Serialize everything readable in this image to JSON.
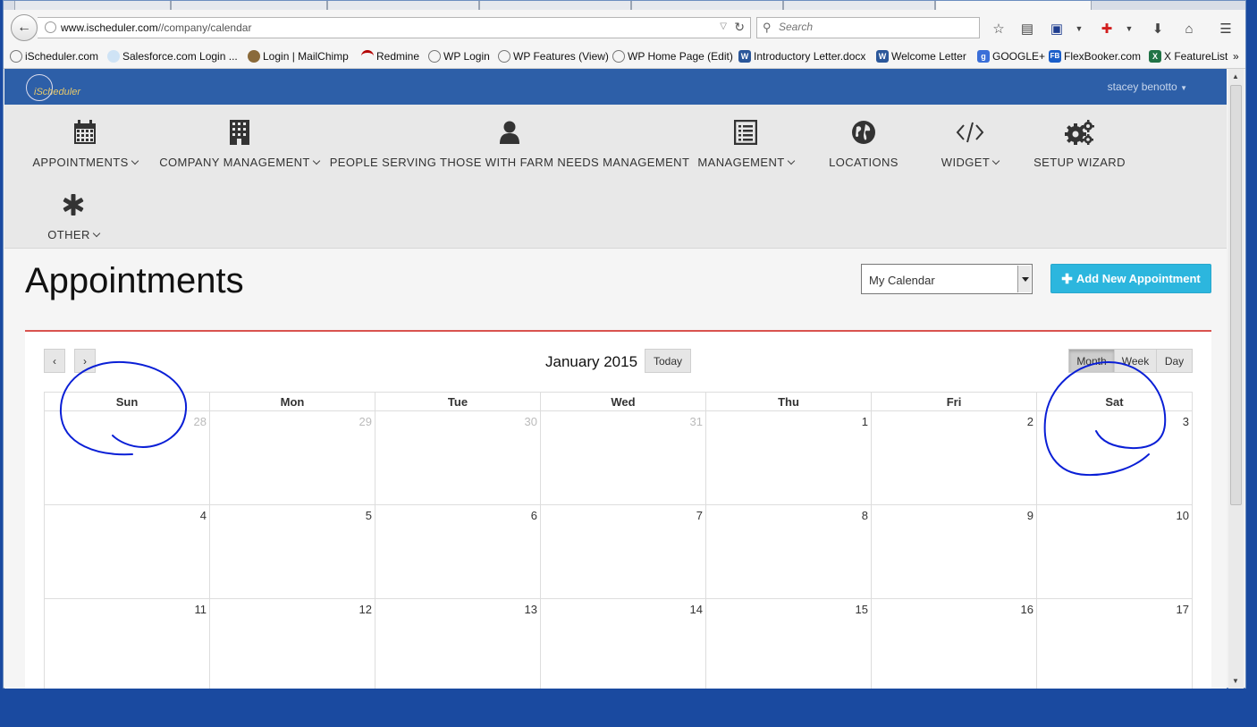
{
  "browser": {
    "url_domain": "www.ischeduler.com",
    "url_path": "//company/calendar",
    "search_placeholder": "Search"
  },
  "bookmarks": [
    {
      "label": "iScheduler.com",
      "icon": "check-circle-icon"
    },
    {
      "label": "Salesforce.com Login ...",
      "icon": "cloud-icon"
    },
    {
      "label": "Login | MailChimp",
      "icon": "chimp-icon"
    },
    {
      "label": "Redmine",
      "icon": "redmine-icon"
    },
    {
      "label": "WP Login",
      "icon": "check-circle-icon"
    },
    {
      "label": "WP Features (View)",
      "icon": "check-circle-icon"
    },
    {
      "label": "WP Home Page (Edit)",
      "icon": "check-circle-icon"
    },
    {
      "label": "Introductory Letter.docx",
      "icon": "word-icon"
    },
    {
      "label": "Welcome Letter",
      "icon": "word-icon"
    },
    {
      "label": "GOOGLE+",
      "icon": "google-icon"
    },
    {
      "label": "FlexBooker.com",
      "icon": "fb-icon"
    },
    {
      "label": "X FeatureList",
      "icon": "excel-icon"
    }
  ],
  "bookmarks_overflow": "»",
  "app": {
    "logo_text": "iScheduler",
    "user_name": "stacey benotto",
    "nav": [
      {
        "label": "APPOINTMENTS",
        "icon": "calendar-icon",
        "dropdown": true
      },
      {
        "label": "COMPANY MANAGEMENT",
        "icon": "building-icon",
        "dropdown": true
      },
      {
        "label": "PEOPLE SERVING THOSE WITH FARM NEEDS MANAGEMENT",
        "icon": "user-icon",
        "dropdown": false
      },
      {
        "label": "MANAGEMENT",
        "icon": "list-icon",
        "dropdown": true
      },
      {
        "label": "LOCATIONS",
        "icon": "globe-icon",
        "dropdown": false
      },
      {
        "label": "WIDGET",
        "icon": "code-icon",
        "dropdown": true
      },
      {
        "label": "SETUP WIZARD",
        "icon": "gears-icon",
        "dropdown": false
      },
      {
        "label": "OTHER",
        "icon": "asterisk-icon",
        "dropdown": true
      }
    ],
    "page_title": "Appointments",
    "calendar_select": "My Calendar",
    "add_button": "Add New Appointment"
  },
  "calendar": {
    "prev": "‹",
    "next": "›",
    "title": "January 2015",
    "today": "Today",
    "views": [
      "Month",
      "Week",
      "Day"
    ],
    "active_view": "Month",
    "days": [
      "Sun",
      "Mon",
      "Tue",
      "Wed",
      "Thu",
      "Fri",
      "Sat"
    ],
    "weeks": [
      [
        {
          "d": "28",
          "other": true
        },
        {
          "d": "29",
          "other": true
        },
        {
          "d": "30",
          "other": true
        },
        {
          "d": "31",
          "other": true
        },
        {
          "d": "1"
        },
        {
          "d": "2"
        },
        {
          "d": "3"
        }
      ],
      [
        {
          "d": "4"
        },
        {
          "d": "5"
        },
        {
          "d": "6"
        },
        {
          "d": "7"
        },
        {
          "d": "8"
        },
        {
          "d": "9"
        },
        {
          "d": "10"
        }
      ],
      [
        {
          "d": "11"
        },
        {
          "d": "12"
        },
        {
          "d": "13"
        },
        {
          "d": "14"
        },
        {
          "d": "15"
        },
        {
          "d": "16"
        },
        {
          "d": "17"
        }
      ]
    ]
  },
  "colors": {
    "header_blue": "#2d5fa8",
    "accent_cyan": "#2cb6de",
    "rule_red": "#d9534f",
    "annotation_blue": "#0a1fd6"
  }
}
